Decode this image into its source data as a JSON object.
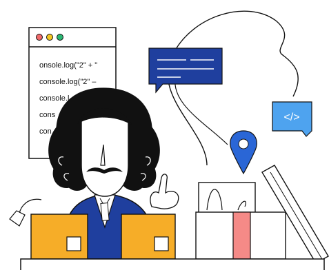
{
  "code_window": {
    "lines": [
      "onsole.log(\"2\" + \"",
      "console.log(\"2\" –",
      "console.l",
      "cons",
      "con"
    ]
  },
  "code_bubble": {
    "glyph": "</>"
  },
  "colors": {
    "ink": "#111111",
    "window_red": "#f06a6a",
    "window_yellow": "#f3c623",
    "window_green": "#2bb673",
    "chat_bubble": "#1f3f9e",
    "code_bubble": "#4ea3ef",
    "pin": "#2a66d6",
    "box_orange": "#f6ad28",
    "coat": "#1f3f9e",
    "ribbon": "#f58a87"
  }
}
